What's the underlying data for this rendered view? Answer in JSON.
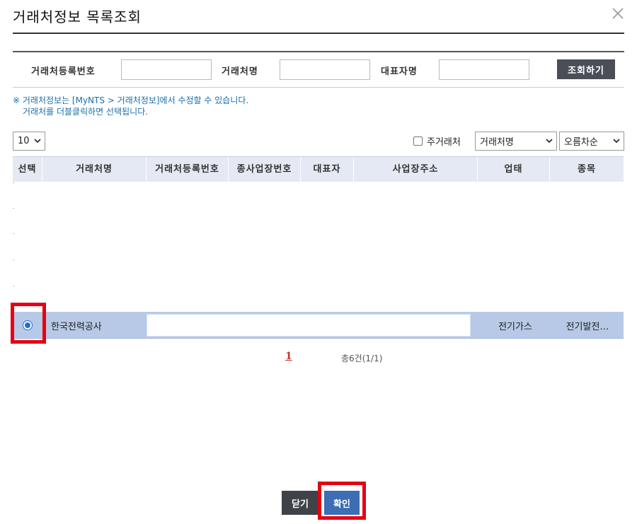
{
  "dialog": {
    "title": "거래처정보 목록조회"
  },
  "search": {
    "reg_no_label": "거래처등록번호",
    "reg_no_value": "",
    "name_label": "거래처명",
    "name_value": "",
    "rep_label": "대표자명",
    "rep_value": "",
    "search_button": "조회하기"
  },
  "notice": {
    "line1": "※ 거래처정보는 [MyNTS > 거래처정보]에서 수정할 수 있습니다.",
    "line2": "거래처를 더블클릭하면 선택됩니다."
  },
  "toolbar": {
    "page_size": "10",
    "favorite_label": "주거래처",
    "sort_key": "거래처명",
    "sort_order": "오름차순"
  },
  "table": {
    "headers": [
      "선택",
      "거래처명",
      "거래처등록번호",
      "종사업장번호",
      "대표자",
      "사업장주소",
      "업태",
      "종목"
    ],
    "rows": [
      {
        "name": "한국전력공사",
        "reg_no": "",
        "sub_no": "",
        "rep": "",
        "address": "",
        "biz_type": "전기가스",
        "biz_item": "전기발전…",
        "selected": true
      }
    ]
  },
  "pagination": {
    "current": "1",
    "total": "총6건(1/1)"
  },
  "footer": {
    "close_button": "닫기",
    "confirm_button": "확인"
  },
  "colors": {
    "accent": "#3c6db5",
    "highlight": "#e60012",
    "notice": "#1a6fa8",
    "header_bg": "#e4e9f3",
    "selected_row": "#b7c9e6"
  }
}
